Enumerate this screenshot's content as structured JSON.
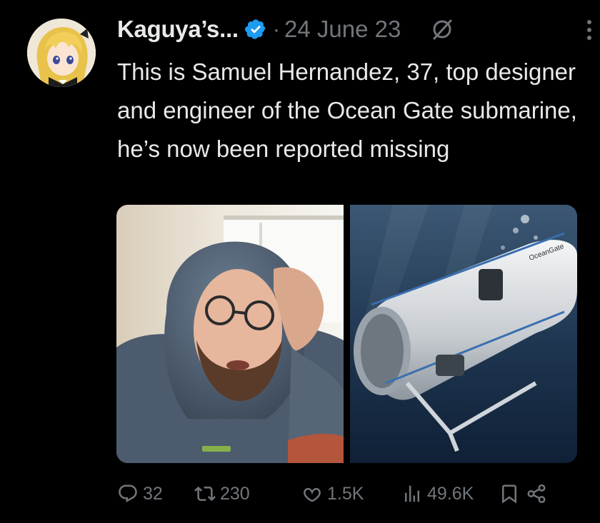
{
  "tweet": {
    "author_name": "Kaguya’s...",
    "separator": "·",
    "date": "24 June 23",
    "text": "This is Samuel Hernandez, 37, top designer and engineer of the Ocean Gate submarine, he’s now been reported missing"
  },
  "media": [
    {
      "description_icon": "photo-man-in-hoodie"
    },
    {
      "description_icon": "photo-submarine-underwater"
    }
  ],
  "actions": {
    "replies": "32",
    "reposts": "230",
    "likes": "1.5K",
    "views": "49.6K"
  },
  "icons": {
    "verified": "verified-badge-icon",
    "grok": "grok-icon",
    "more": "more-options-icon",
    "reply": "reply-icon",
    "repost": "repost-icon",
    "like": "like-icon",
    "views": "views-icon",
    "bookmark": "bookmark-icon",
    "share": "share-icon"
  },
  "colors": {
    "background": "#000000",
    "text_primary": "#e7e9ea",
    "text_secondary": "#71767b",
    "verified_blue": "#1d9bf0"
  }
}
